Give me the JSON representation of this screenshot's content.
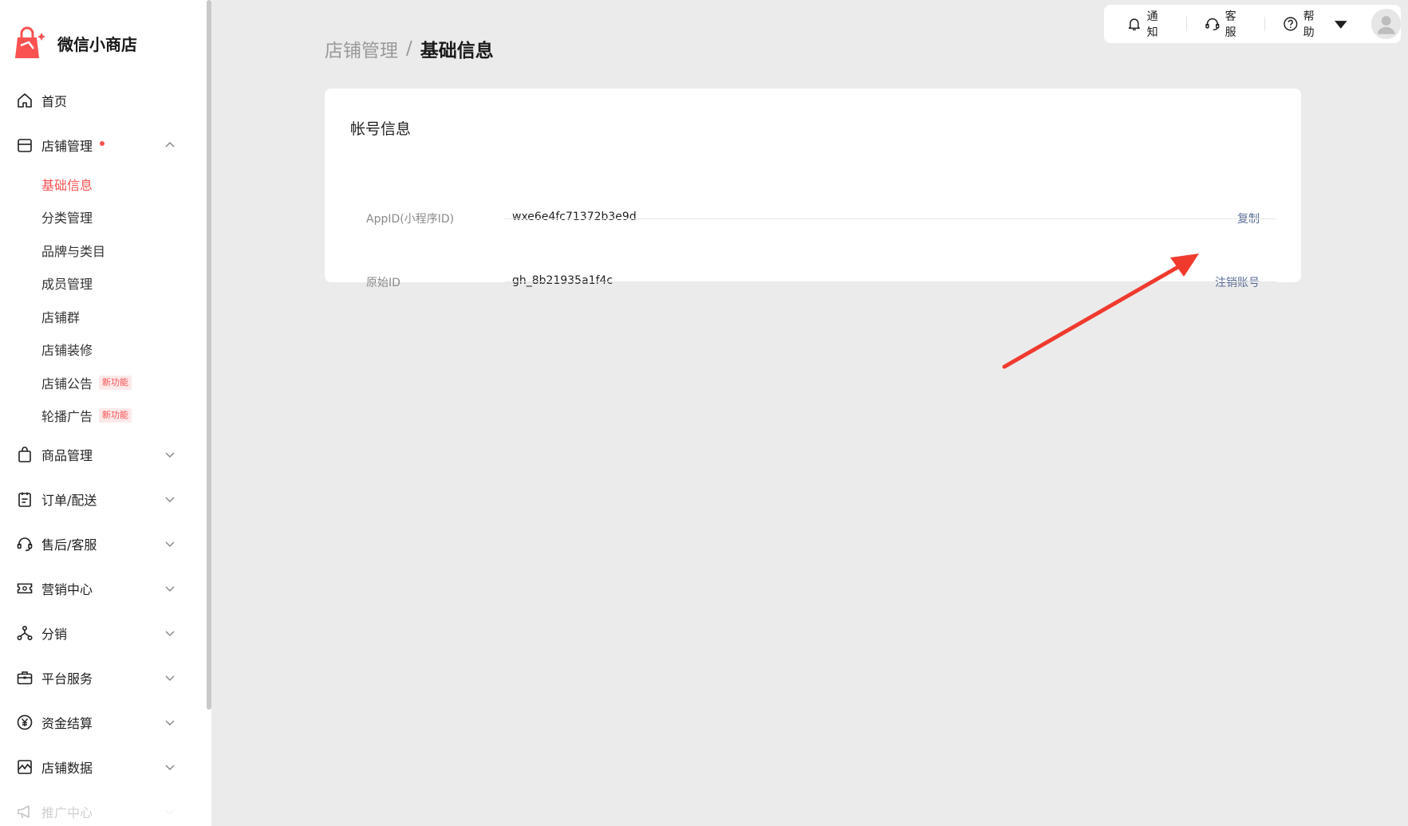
{
  "brand": {
    "name": "微信小商店"
  },
  "sidebar": {
    "items": [
      {
        "label": "首页",
        "icon": "home-icon"
      },
      {
        "label": "店铺管理",
        "icon": "store-icon",
        "has_dot": true,
        "expanded": true,
        "children": [
          {
            "label": "基础信息",
            "active": true
          },
          {
            "label": "分类管理"
          },
          {
            "label": "品牌与类目"
          },
          {
            "label": "成员管理"
          },
          {
            "label": "店铺群"
          },
          {
            "label": "店铺装修"
          },
          {
            "label": "店铺公告",
            "badge": "新功能"
          },
          {
            "label": "轮播广告",
            "badge": "新功能"
          }
        ]
      },
      {
        "label": "商品管理",
        "icon": "bag-icon"
      },
      {
        "label": "订单/配送",
        "icon": "clipboard-icon"
      },
      {
        "label": "售后/客服",
        "icon": "headset-icon"
      },
      {
        "label": "营销中心",
        "icon": "ticket-icon"
      },
      {
        "label": "分销",
        "icon": "share-icon"
      },
      {
        "label": "平台服务",
        "icon": "briefcase-icon"
      },
      {
        "label": "资金结算",
        "icon": "yuan-icon"
      },
      {
        "label": "店铺数据",
        "icon": "chart-icon"
      },
      {
        "label": "推广中心",
        "icon": "megaphone-icon"
      }
    ]
  },
  "topbar": {
    "notify": "通知",
    "service": "客服",
    "help": "帮助"
  },
  "breadcrumb": {
    "parent": "店铺管理",
    "separator": "/",
    "current": "基础信息"
  },
  "account_card": {
    "title": "帐号信息",
    "rows": [
      {
        "key": "AppID(小程序ID)",
        "value": "wxe6e4fc71372b3e9d",
        "action": "复制"
      },
      {
        "key": "原始ID",
        "value": "gh_8b21935a1f4c",
        "action": "注销账号"
      }
    ]
  },
  "colors": {
    "accent": "#fa5151",
    "link": "#576b95",
    "background": "#ebebeb",
    "arrow": "#f03a2e"
  }
}
